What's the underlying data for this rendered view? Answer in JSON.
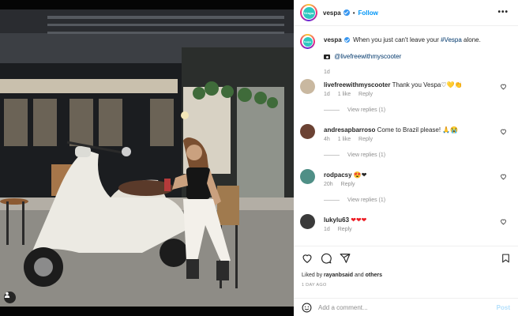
{
  "post": {
    "username": "vespa",
    "follow_label": "Follow",
    "separator": "•",
    "more_label": "•••",
    "brand_color": "#2ec8c0",
    "avatar_text": "Vespa",
    "caption": {
      "username": "vespa",
      "text": "When you just can't leave your",
      "hashtag": "#Vespa",
      "tail": "alone.",
      "credit_icon": "camera-icon",
      "credit": "@livefreewithmyscooter",
      "time": "1d"
    }
  },
  "comments": [
    {
      "username": "livefreewithmyscooter",
      "text": "Thank you Vespa",
      "emojis": "♡💛👏",
      "time": "1d",
      "likes": "1 like",
      "reply": "Reply",
      "view_replies": "View replies (1)"
    },
    {
      "username": "andresapbarroso",
      "text": "Come to Brazil please!",
      "emojis": "🙏😭",
      "time": "4h",
      "likes": "1 like",
      "reply": "Reply",
      "view_replies": "View replies (1)"
    },
    {
      "username": "rodpacsy",
      "text": "",
      "emojis": "😍❤",
      "time": "20h",
      "likes": "",
      "reply": "Reply",
      "view_replies": "View replies (1)"
    },
    {
      "username": "lukylu63",
      "text": "",
      "emojis": "❤❤❤",
      "time": "1d",
      "likes": "",
      "reply": "Reply",
      "view_replies": ""
    }
  ],
  "actions": {
    "liked_by_prefix": "Liked by",
    "liked_by_user": "rayanbsaid",
    "liked_by_suffix": "and",
    "liked_by_others": "others",
    "timestamp": "1 DAY AGO"
  },
  "add_comment": {
    "placeholder": "Add a comment...",
    "post_label": "Post"
  }
}
